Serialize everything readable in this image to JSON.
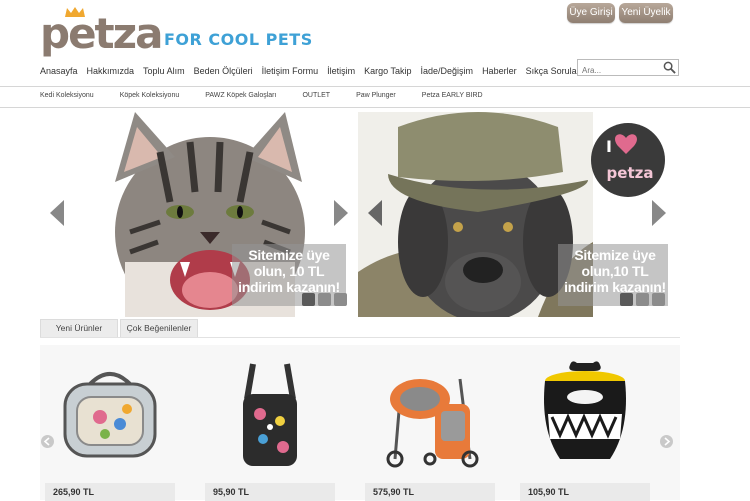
{
  "brand": {
    "logo_text": "petza",
    "tagline": "FOR COOL PETS"
  },
  "auth": {
    "login_label": "Üye Girişi",
    "register_label": "Yeni Üyelik"
  },
  "main_nav": [
    "Anasayfa",
    "Hakkımızda",
    "Toplu Alım",
    "Beden Ölçüleri",
    "İletişim Formu",
    "İletişim",
    "Kargo Takip",
    "İade/Değişim",
    "Haberler",
    "Sıkça Sorulan Sorular"
  ],
  "search": {
    "placeholder": "Ara..."
  },
  "sub_nav": [
    "Kedi Koleksiyonu",
    "Köpek Koleksiyonu",
    "PAWZ Köpek Galoşları",
    "OUTLET",
    "Paw Plunger",
    "Petza EARLY BIRD"
  ],
  "sliders": [
    {
      "promo_line1": "Sitemize üye",
      "promo_line2": "olun, 10 TL",
      "promo_line3": "indirim kazanın!"
    },
    {
      "promo_line1": "Sitemize üye",
      "promo_line2": "olun,10 TL",
      "promo_line3": "indirim kazanın!",
      "badge_word": "petza"
    }
  ],
  "tabs": [
    "Yeni Ürünler",
    "Çok Beğenilenler"
  ],
  "products": [
    {
      "price": "265,90 TL"
    },
    {
      "price": "95,90 TL"
    },
    {
      "price": "575,90 TL"
    },
    {
      "price": "105,90 TL"
    }
  ],
  "colors": {
    "brand_brown": "#8b7b70",
    "brand_blue": "#3ea1d6",
    "heart_pink": "#e06a8e"
  },
  "icons": [
    "crown-icon",
    "search-icon",
    "chevron-left-icon",
    "chevron-right-icon",
    "heart-icon"
  ]
}
